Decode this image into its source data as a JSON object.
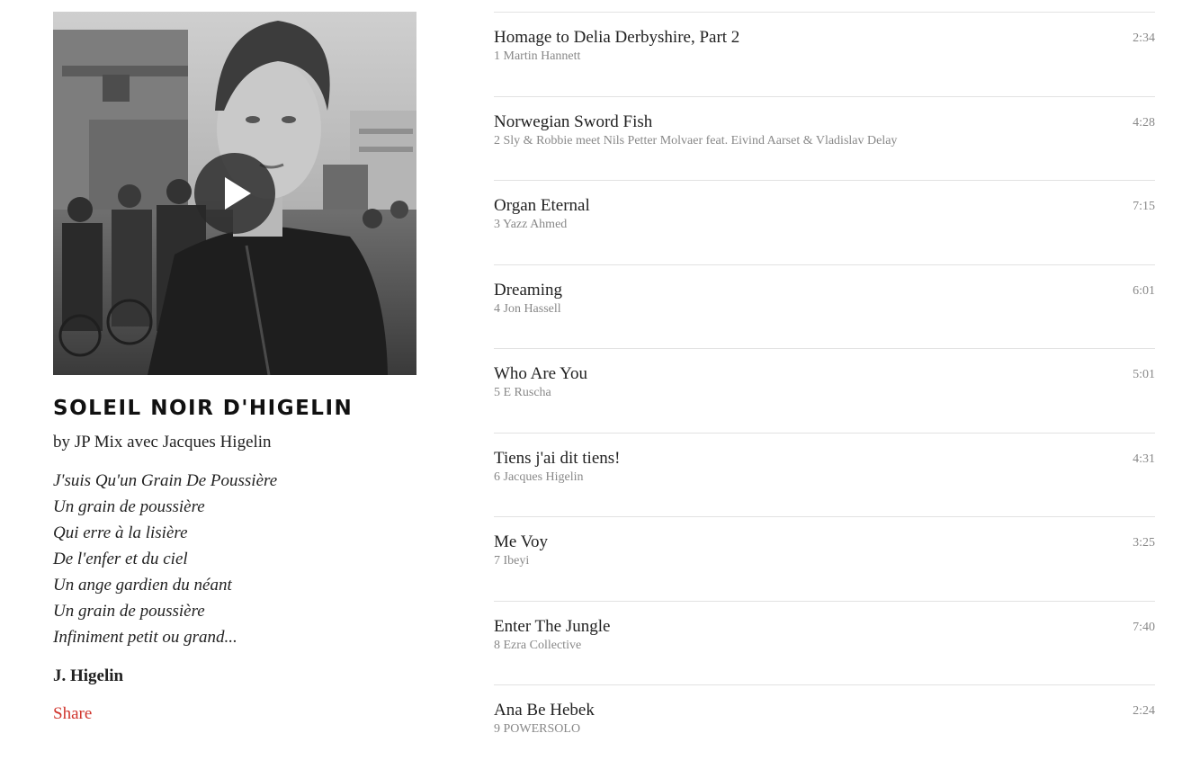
{
  "mix": {
    "title": "SOLEIL NOIR D'HIGELIN",
    "byline": "by JP Mix avec Jacques Higelin",
    "lyrics": [
      "J'suis Qu'un Grain De Poussière",
      "Un grain de poussière",
      "Qui erre à la lisière",
      "De l'enfer et du ciel",
      "Un ange gardien du néant",
      "Un grain de poussière",
      "Infiniment petit ou grand..."
    ],
    "signature": "J. Higelin",
    "share_label": "Share",
    "cover_icon": "play-icon"
  },
  "colors": {
    "share": "#d0342c",
    "divider": "#e2e2e2",
    "muted": "#888888",
    "text": "#222222"
  },
  "tracks": [
    {
      "title": "Homage to Delia Derbyshire, Part 2",
      "number": "1",
      "artist": "Martin Hannett",
      "duration": "2:34"
    },
    {
      "title": "Norwegian Sword Fish",
      "number": "2",
      "artist": "Sly & Robbie meet Nils Petter Molvaer feat. Eivind Aarset & Vladislav Delay",
      "duration": "4:28"
    },
    {
      "title": "Organ Eternal",
      "number": "3",
      "artist": "Yazz Ahmed",
      "duration": "7:15"
    },
    {
      "title": "Dreaming",
      "number": "4",
      "artist": "Jon Hassell",
      "duration": "6:01"
    },
    {
      "title": "Who Are You",
      "number": "5",
      "artist": "E Ruscha",
      "duration": "5:01"
    },
    {
      "title": "Tiens j'ai dit tiens!",
      "number": "6",
      "artist": "Jacques Higelin",
      "duration": "4:31"
    },
    {
      "title": "Me Voy",
      "number": "7",
      "artist": "Ibeyi",
      "duration": "3:25"
    },
    {
      "title": "Enter The Jungle",
      "number": "8",
      "artist": "Ezra Collective",
      "duration": "7:40"
    },
    {
      "title": "Ana Be Hebek",
      "number": "9",
      "artist": "POWERSOLO",
      "duration": "2:24"
    }
  ]
}
